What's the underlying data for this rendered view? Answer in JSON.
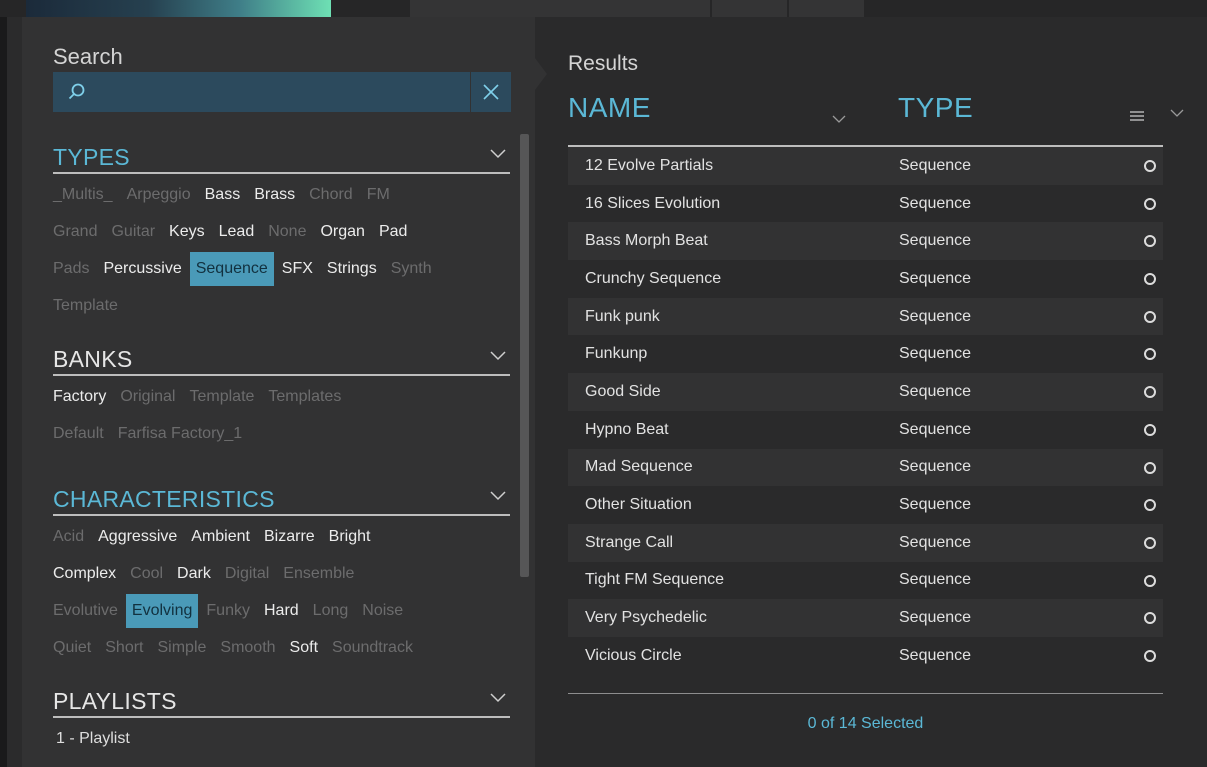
{
  "search": {
    "title": "Search",
    "query": "",
    "search_icon": "search-icon",
    "clear_icon": "close-icon"
  },
  "types": {
    "title": "TYPES",
    "rows": [
      [
        {
          "label": "_Multis_",
          "state": "dim"
        },
        {
          "label": "Arpeggio",
          "state": "dim"
        },
        {
          "label": "Bass",
          "state": "on"
        },
        {
          "label": "Brass",
          "state": "on"
        },
        {
          "label": "Chord",
          "state": "dim"
        },
        {
          "label": "FM",
          "state": "dim"
        }
      ],
      [
        {
          "label": "Grand",
          "state": "dim"
        },
        {
          "label": "Guitar",
          "state": "dim"
        },
        {
          "label": "Keys",
          "state": "on"
        },
        {
          "label": "Lead",
          "state": "on"
        },
        {
          "label": "None",
          "state": "dim"
        },
        {
          "label": "Organ",
          "state": "on"
        },
        {
          "label": "Pad",
          "state": "on"
        }
      ],
      [
        {
          "label": "Pads",
          "state": "dim"
        },
        {
          "label": "Percussive",
          "state": "on"
        },
        {
          "label": "Sequence",
          "state": "sel"
        },
        {
          "label": "SFX",
          "state": "on"
        },
        {
          "label": "Strings",
          "state": "on"
        },
        {
          "label": "Synth",
          "state": "dim"
        }
      ],
      [
        {
          "label": "Template",
          "state": "dim"
        }
      ]
    ]
  },
  "banks": {
    "title": "BANKS",
    "rows": [
      [
        {
          "label": "Factory",
          "state": "on"
        },
        {
          "label": "Original",
          "state": "dim"
        },
        {
          "label": "Template",
          "state": "dim"
        },
        {
          "label": "Templates",
          "state": "dim"
        }
      ],
      [
        {
          "label": "Default",
          "state": "dim"
        },
        {
          "label": "Farfisa Factory_1",
          "state": "dim"
        }
      ]
    ]
  },
  "characteristics": {
    "title": "CHARACTERISTICS",
    "rows": [
      [
        {
          "label": "Acid",
          "state": "dim"
        },
        {
          "label": "Aggressive",
          "state": "on"
        },
        {
          "label": "Ambient",
          "state": "on"
        },
        {
          "label": "Bizarre",
          "state": "on"
        },
        {
          "label": "Bright",
          "state": "on"
        }
      ],
      [
        {
          "label": "Complex",
          "state": "on"
        },
        {
          "label": "Cool",
          "state": "dim"
        },
        {
          "label": "Dark",
          "state": "on"
        },
        {
          "label": "Digital",
          "state": "dim"
        },
        {
          "label": "Ensemble",
          "state": "dim"
        }
      ],
      [
        {
          "label": "Evolutive",
          "state": "dim"
        },
        {
          "label": "Evolving",
          "state": "sel"
        },
        {
          "label": "Funky",
          "state": "dim"
        },
        {
          "label": "Hard",
          "state": "on"
        },
        {
          "label": "Long",
          "state": "dim"
        },
        {
          "label": "Noise",
          "state": "dim"
        }
      ],
      [
        {
          "label": "Quiet",
          "state": "dim"
        },
        {
          "label": "Short",
          "state": "dim"
        },
        {
          "label": "Simple",
          "state": "dim"
        },
        {
          "label": "Smooth",
          "state": "dim"
        },
        {
          "label": "Soft",
          "state": "on"
        },
        {
          "label": "Soundtrack",
          "state": "dim"
        }
      ]
    ]
  },
  "playlists": {
    "title": "PLAYLISTS",
    "items": [
      "1 - Playlist"
    ]
  },
  "results": {
    "title": "Results",
    "col_name": "NAME",
    "col_type": "TYPE",
    "rows": [
      {
        "name": "12 Evolve Partials",
        "type": "Sequence"
      },
      {
        "name": "16 Slices Evolution",
        "type": "Sequence"
      },
      {
        "name": "Bass Morph Beat",
        "type": "Sequence"
      },
      {
        "name": "Crunchy Sequence",
        "type": "Sequence"
      },
      {
        "name": "Funk punk",
        "type": "Sequence"
      },
      {
        "name": "Funkunp",
        "type": "Sequence"
      },
      {
        "name": "Good Side",
        "type": "Sequence"
      },
      {
        "name": "Hypno Beat",
        "type": "Sequence"
      },
      {
        "name": "Mad Sequence",
        "type": "Sequence"
      },
      {
        "name": "Other Situation",
        "type": "Sequence"
      },
      {
        "name": "Strange Call",
        "type": "Sequence"
      },
      {
        "name": "Tight FM Sequence",
        "type": "Sequence"
      },
      {
        "name": "Very Psychedelic",
        "type": "Sequence"
      },
      {
        "name": "Vicious Circle",
        "type": "Sequence"
      }
    ],
    "selected_text": "0 of 14 Selected"
  },
  "colors": {
    "accent": "#5bb8d6",
    "selected_tag_bg": "#4a9ab8",
    "search_box_bg": "#2c4a5d"
  }
}
